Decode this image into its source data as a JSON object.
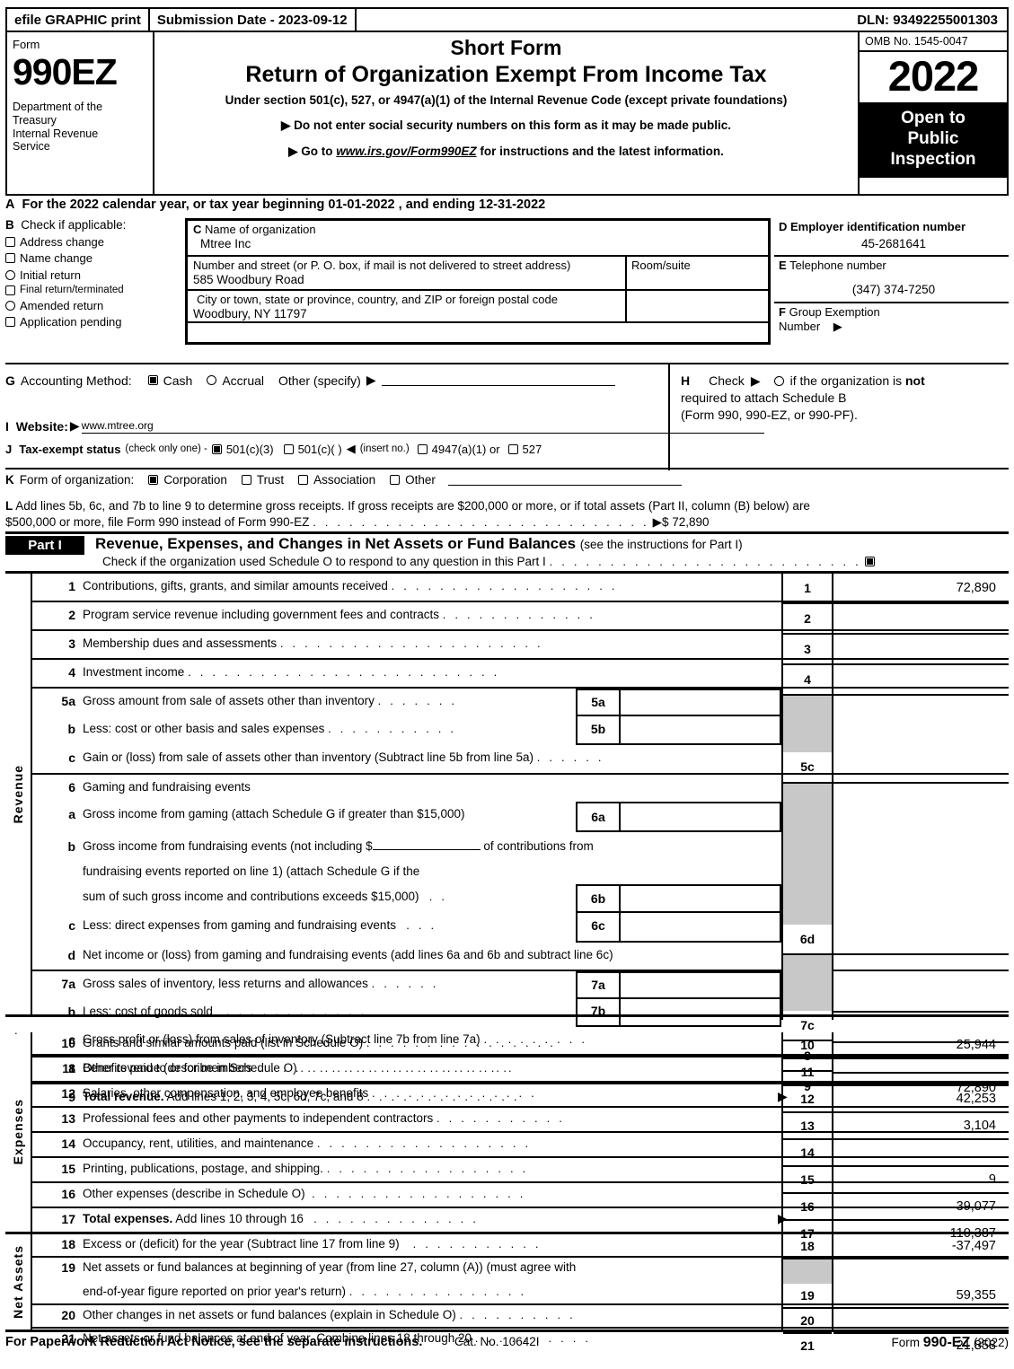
{
  "efile": {
    "graphic_print": "efile GRAPHIC print",
    "submission_date": "Submission Date - 2023-09-12",
    "dln": "DLN: 93492255001303"
  },
  "masthead": {
    "form_label": "Form",
    "form_number": "990EZ",
    "department": "Department of the Treasury Internal Revenue Service",
    "short_form": "Short Form",
    "title": "Return of Organization Exempt From Income Tax",
    "under_section": "Under section 501(c), 527, or 4947(a)(1) of the Internal Revenue Code (except private foundations)",
    "bullet1": "Do not enter social security numbers on this form as it may be made public.",
    "bullet2_pre": "Go to ",
    "bullet2_link": "www.irs.gov/Form990EZ",
    "bullet2_post": " for instructions and the latest information.",
    "omb": "OMB No. 1545-0047",
    "year": "2022",
    "open_to_public": "Open to Public Inspection"
  },
  "lineA": {
    "letter": "A",
    "text": "For the 2022 calendar year, or tax year beginning 01-01-2022 , and ending 12-31-2022"
  },
  "blockB": {
    "letter": "B",
    "header": "Check if applicable:",
    "items": [
      {
        "label": "Address change",
        "checked": false,
        "shape": "square"
      },
      {
        "label": "Name change",
        "checked": false,
        "shape": "square"
      },
      {
        "label": "Initial return",
        "checked": false,
        "shape": "oval"
      },
      {
        "label": "Final return/terminated",
        "checked": false,
        "shape": "square",
        "small": true
      },
      {
        "label": "Amended return",
        "checked": false,
        "shape": "oval"
      },
      {
        "label": "Application pending",
        "checked": false,
        "shape": "square"
      }
    ]
  },
  "blockC": {
    "letter": "C",
    "name_label": "Name of organization",
    "name_value": "Mtree Inc",
    "street_label": "Number and street (or P. O. box, if mail is not delivered to street address)",
    "street_value": "585 Woodbury Road",
    "room_label": "Room/suite",
    "room_value": "",
    "city_label": "City or town, state or province, country, and ZIP or foreign postal code",
    "city_value": "Woodbury, NY   11797"
  },
  "blockD": {
    "d_letter": "D",
    "d_label": "Employer identification number",
    "d_value": "45-2681641",
    "e_letter": "E",
    "e_label": "Telephone number",
    "e_value": "(347) 374-7250",
    "f_letter": "F",
    "f_label": "Group Exemption",
    "f_label2": "Number",
    "f_value": ""
  },
  "blockG": {
    "letter": "G",
    "label": "Accounting Method:",
    "cash": "Cash",
    "cash_checked": true,
    "accrual": "Accrual",
    "accrual_checked": false,
    "other": "Other (specify)",
    "other_value": ""
  },
  "blockH": {
    "letter": "H",
    "check_label": "Check",
    "line1_a": "if the organization is ",
    "line1_b": "not",
    "line2": "required to attach Schedule B",
    "line3": "(Form 990, 990-EZ, or 990-PF).",
    "checked": false
  },
  "blockI": {
    "letter": "I",
    "label": "Website:",
    "value": "www.mtree.org"
  },
  "blockJ": {
    "letter": "J",
    "label": "Tax-exempt status",
    "note": "(check only one) -",
    "options": [
      {
        "label": "501(c)(3)",
        "checked": true
      },
      {
        "label": "501(c)(    )",
        "checked": false
      },
      {
        "label": "4947(a)(1) or",
        "checked": false
      },
      {
        "label": "527",
        "checked": false
      }
    ],
    "insert_no": "(insert no.)"
  },
  "blockK": {
    "letter": "K",
    "label": "Form of organization:",
    "options": [
      {
        "label": "Corporation",
        "checked": true
      },
      {
        "label": "Trust",
        "checked": false
      },
      {
        "label": "Association",
        "checked": false
      },
      {
        "label": "Other",
        "checked": false
      }
    ]
  },
  "blockL": {
    "letter": "L",
    "line1": "Add lines 5b, 6c, and 7b to line 9 to determine gross receipts. If gross receipts are $200,000 or more, or if total assets (Part II, column (B) below) are",
    "line2": "$500,000 or more, file Form 990 instead of Form 990-EZ",
    "amount": "$ 72,890"
  },
  "partI": {
    "tag": "Part I",
    "title": "Revenue, Expenses, and Changes in Net Assets or Fund Balances",
    "title_note": "(see the instructions for Part I)",
    "subtitle": "Check if the organization used Schedule O to respond to any question in this Part I",
    "sub_checked": true
  },
  "sections": [
    {
      "vlabel": "Revenue",
      "rows": [
        {
          "num": "1",
          "text": "Contributions, gifts, grants, and similar amounts received",
          "dots": true,
          "box": "1",
          "value": "72,890"
        },
        {
          "num": "2",
          "text": "Program service revenue including government fees and contracts",
          "dots": true,
          "box": "2",
          "value": ""
        },
        {
          "num": "3",
          "text": "Membership dues and assessments",
          "dots": true,
          "box": "3",
          "value": ""
        },
        {
          "num": "4",
          "text": "Investment income",
          "dots": true,
          "box": "4",
          "value": ""
        },
        {
          "num": "5a",
          "text": "Gross amount from sale of assets other than inventory",
          "dots": true,
          "sub": "5a",
          "subvalue": "",
          "greyA": true
        },
        {
          "num": "b",
          "text": "Less: cost or other basis and sales expenses",
          "dots": true,
          "sub": "5b",
          "subvalue": "",
          "greyA": true
        },
        {
          "num": "c",
          "text": "Gain or (loss) from sale of assets other than inventory (Subtract line 5b from line 5a)",
          "dots": true,
          "box": "5c",
          "value": ""
        },
        {
          "num": "6",
          "text": "Gaming and fundraising events",
          "dots": false,
          "greyA": true
        },
        {
          "num": "a",
          "text": "Gross income from gaming (attach Schedule G if greater than $15,000)",
          "dots": false,
          "sub": "6a",
          "subvalue": "",
          "greyA": true
        },
        {
          "num": "b",
          "text": "Gross income from fundraising events (not including $______________ of contributions from",
          "dots": false,
          "greyA": true
        },
        {
          "num": "",
          "text": "fundraising events reported on line 1) (attach Schedule G if the",
          "dots": false,
          "greyA": true
        },
        {
          "num": "",
          "text": "sum of such gross income and contributions exceeds $15,000)",
          "dots": true,
          "sub": "6b",
          "subvalue": "",
          "greyA": true
        },
        {
          "num": "c",
          "text": "Less: direct expenses from gaming and fundraising events",
          "dots": true,
          "sub": "6c",
          "subvalue": "",
          "greyA": true
        },
        {
          "num": "d",
          "text": "Net income or (loss) from gaming and fundraising events (add lines 6a and 6b and subtract line 6c)",
          "dots": false,
          "box": "6d",
          "value": ""
        },
        {
          "num": "7a",
          "text": "Gross sales of inventory, less returns and allowances",
          "dots": true,
          "sub": "7a",
          "subvalue": "",
          "greyA": true
        },
        {
          "num": "b",
          "text": "Less: cost of goods sold",
          "dots": true,
          "sub": "7b",
          "subvalue": "",
          "greyA": true
        },
        {
          "num": "c",
          "text": "Gross profit or (loss) from sales of inventory (Subtract line 7b from line 7a)",
          "dots": true,
          "box": "7c",
          "value": ""
        },
        {
          "num": "8",
          "text": "Other revenue (describe in Schedule O)",
          "dots": true,
          "box": "8",
          "value": ""
        },
        {
          "num": "9",
          "text": "Total revenue.|Add lines 1, 2, 3, 4, 5c, 6d, 7c, and 8",
          "dots": true,
          "arrow": true,
          "box": "9",
          "value": "72,890"
        }
      ]
    },
    {
      "vlabel": "Expenses",
      "rows": [
        {
          "num": "10",
          "text": "Grants and similar amounts paid (list in Schedule O)",
          "dots": true,
          "box": "10",
          "value": "25,944"
        },
        {
          "num": "11",
          "text": "Benefits paid to or for members",
          "dots": true,
          "box": "11",
          "value": ""
        },
        {
          "num": "12",
          "text": "Salaries, other compensation, and employee benefits",
          "dots": true,
          "box": "12",
          "value": "42,253"
        },
        {
          "num": "13",
          "text": "Professional fees and other payments to independent contractors",
          "dots": true,
          "box": "13",
          "value": "3,104"
        },
        {
          "num": "14",
          "text": "Occupancy, rent, utilities, and maintenance",
          "dots": true,
          "box": "14",
          "value": ""
        },
        {
          "num": "15",
          "text": "Printing, publications, postage, and shipping.",
          "dots": true,
          "box": "15",
          "value": "9"
        },
        {
          "num": "16",
          "text": "Other expenses (describe in Schedule O)",
          "dots": true,
          "box": "16",
          "value": "39,077"
        },
        {
          "num": "17",
          "text": "Total expenses.|Add lines 10 through 16",
          "dots": true,
          "arrow": true,
          "box": "17",
          "value": "110,387"
        }
      ]
    },
    {
      "vlabel": "Net Assets",
      "rows": [
        {
          "num": "18",
          "text": "Excess or (deficit) for the year (Subtract line 17 from line 9)",
          "dots": true,
          "box": "18",
          "value": "-37,497"
        },
        {
          "num": "19",
          "text": "Net assets or fund balances at beginning of year (from line 27, column (A)) (must agree with",
          "dots": false,
          "greyA": true
        },
        {
          "num": "",
          "text": "end-of-year figure reported on prior year's return)",
          "dots": true,
          "box": "19",
          "value": "59,355"
        },
        {
          "num": "20",
          "text": "Other changes in net assets or fund balances (explain in Schedule O)",
          "dots": true,
          "box": "20",
          "value": ""
        },
        {
          "num": "21",
          "text": "Net assets or fund balances at end of year. Combine lines 18 through 20",
          "dots": true,
          "box": "21",
          "value": "21,858"
        }
      ]
    }
  ],
  "footer": {
    "notice": "For Paperwork Reduction Act Notice, see the separate instructions.",
    "cat": "Cat. No. 10642I",
    "form_pre": "Form ",
    "form_bold": "990-EZ",
    "form_post": " (2022)"
  }
}
